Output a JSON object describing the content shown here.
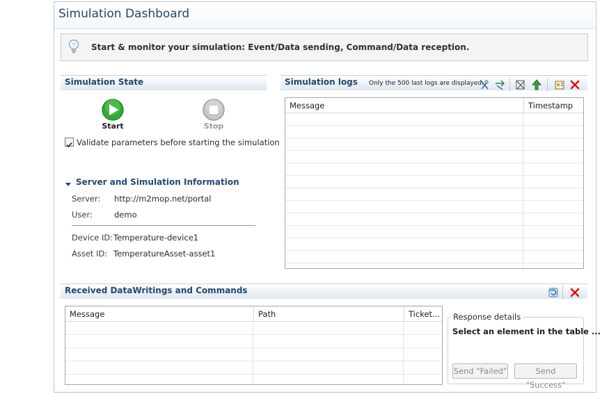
{
  "title": "Simulation Dashboard",
  "banner": {
    "text": "Start & monitor your simulation: Event/Data sending, Command/Data reception.",
    "icon": "lightbulb-icon"
  },
  "state": {
    "title": "Simulation State",
    "start_label": "Start",
    "stop_label": "Stop",
    "validate_label": "Validate parameters before starting the simulation",
    "validate_checked": true
  },
  "info": {
    "title": "Server and Simulation Information",
    "server_label": "Server:",
    "server_value": "http://m2mop.net/portal",
    "user_label": "User:",
    "user_value": "demo",
    "device_label": "Device ID:",
    "device_value": "Temperature-device1",
    "asset_label": "Asset ID:",
    "asset_value": "TemperatureAsset-asset1"
  },
  "logs": {
    "title": "Simulation logs",
    "note": "Only the 500 last logs are displayed.",
    "columns": [
      "Message",
      "Timestamp"
    ],
    "rows": []
  },
  "received": {
    "title": "Received DataWritings and Commands",
    "columns": [
      "Message",
      "Path",
      "Ticket..."
    ],
    "rows": []
  },
  "response": {
    "legend": "Response details",
    "placeholder": "Select an element in the table ...",
    "failed_label": "Send \"Failed\"",
    "success_label": "Send \"Success\""
  },
  "colors": {
    "accent": "#26486b",
    "start_green": "#2ea12e",
    "delete_red": "#d01818"
  }
}
